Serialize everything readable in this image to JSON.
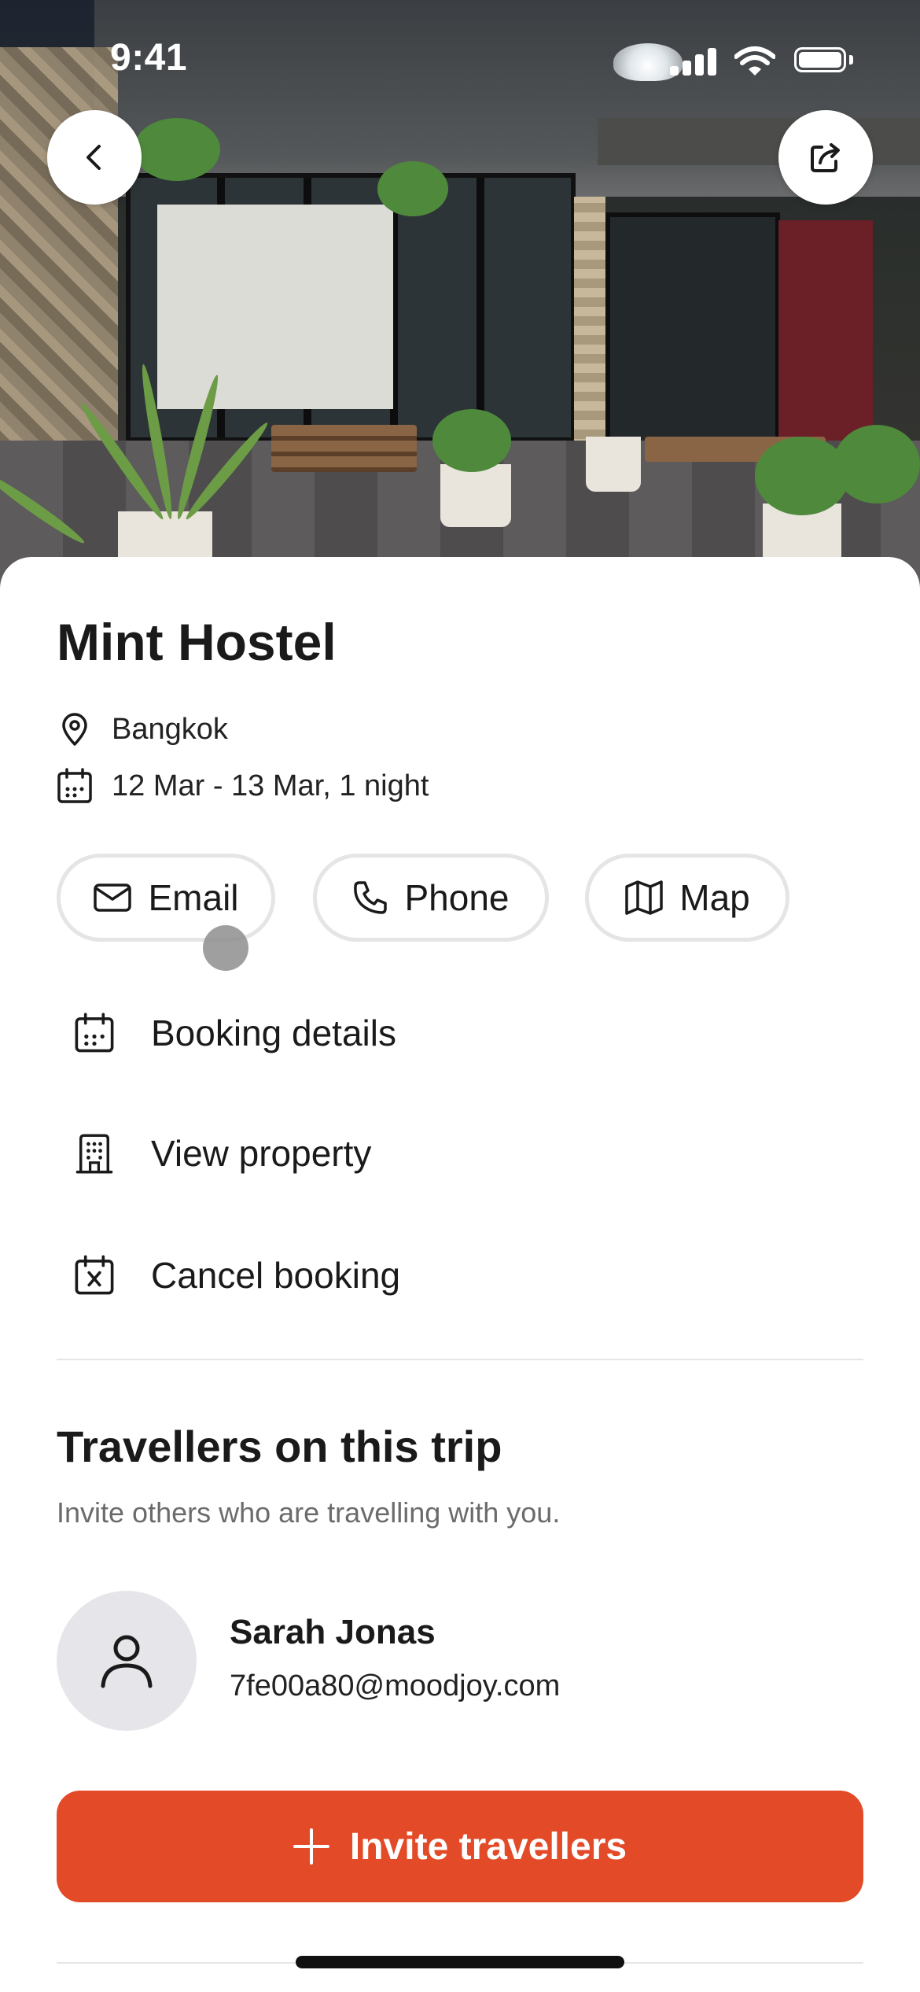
{
  "status_bar": {
    "time": "9:41"
  },
  "hero": {
    "icon_back": "chevron-left-icon",
    "icon_share": "share-icon"
  },
  "property": {
    "name": "Mint Hostel",
    "location": "Bangkok",
    "dates": "12 Mar - 13 Mar, 1 night"
  },
  "contact_actions": [
    {
      "label": "Email",
      "icon": "mail-icon"
    },
    {
      "label": "Phone",
      "icon": "phone-icon"
    },
    {
      "label": "Map",
      "icon": "map-icon"
    }
  ],
  "menu": [
    {
      "label": "Booking details",
      "icon": "calendar-icon"
    },
    {
      "label": "View property",
      "icon": "building-icon"
    },
    {
      "label": "Cancel booking",
      "icon": "calendar-x-icon"
    }
  ],
  "travellers": {
    "title": "Travellers on this trip",
    "subtitle": "Invite others who are travelling with you.",
    "people": [
      {
        "name": "Sarah Jonas",
        "email": "7fe00a80@moodjoy.com"
      }
    ],
    "invite_label": "Invite travellers"
  },
  "colors": {
    "accent": "#e34a27",
    "pill_border": "#e5e5e5",
    "muted_text": "#6b6b6b"
  }
}
